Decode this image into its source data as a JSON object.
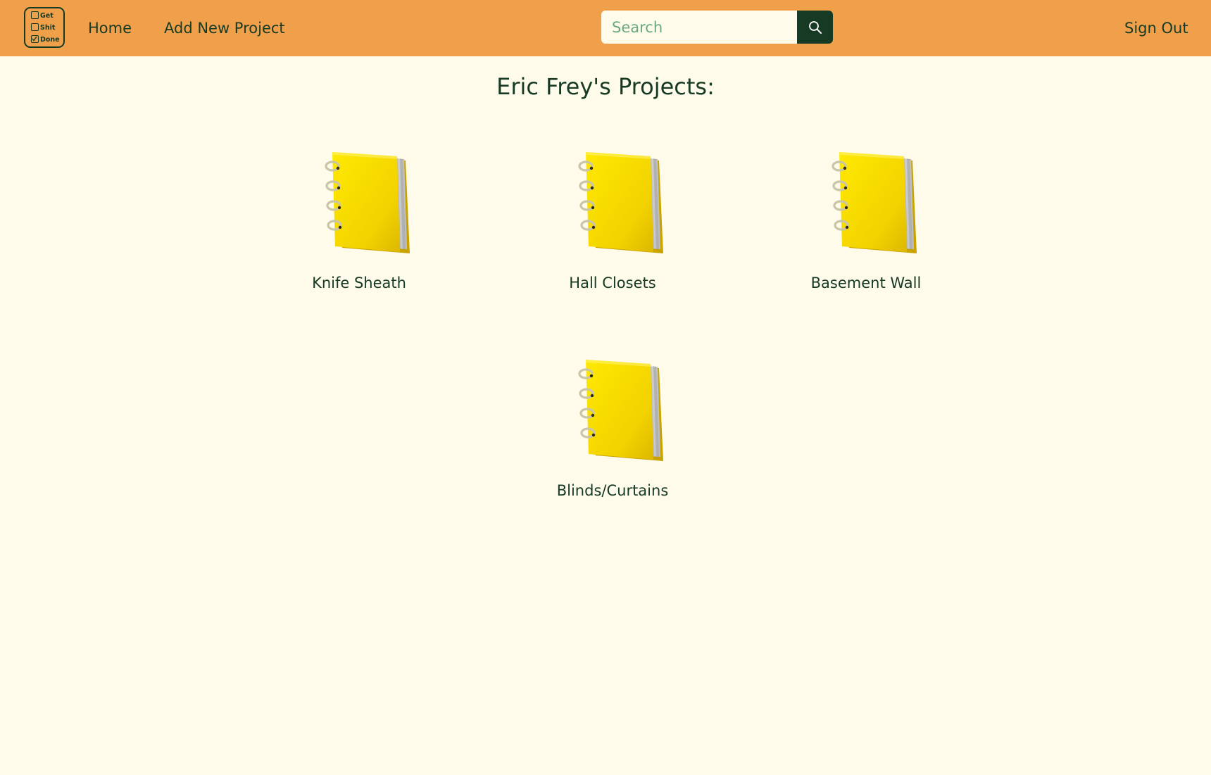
{
  "app": {
    "logo_lines": [
      "Get",
      "Shit",
      "Done"
    ]
  },
  "nav": {
    "home_label": "Home",
    "add_project_label": "Add New Project",
    "sign_out_label": "Sign Out"
  },
  "search": {
    "placeholder": "Search",
    "value": "",
    "icon": "search-icon"
  },
  "main": {
    "title": "Eric Frey's Projects:",
    "project_icon": "notebook-icon",
    "projects": [
      {
        "name": "Knife Sheath"
      },
      {
        "name": "Hall Closets"
      },
      {
        "name": "Basement Wall"
      },
      {
        "name": "Blinds/Curtains"
      }
    ]
  },
  "colors": {
    "navbar": "#f0a04b",
    "background": "#fffbea",
    "text": "#163a24",
    "search_button": "#163a24",
    "placeholder": "#6aa884",
    "notebook": "#f5d800"
  }
}
